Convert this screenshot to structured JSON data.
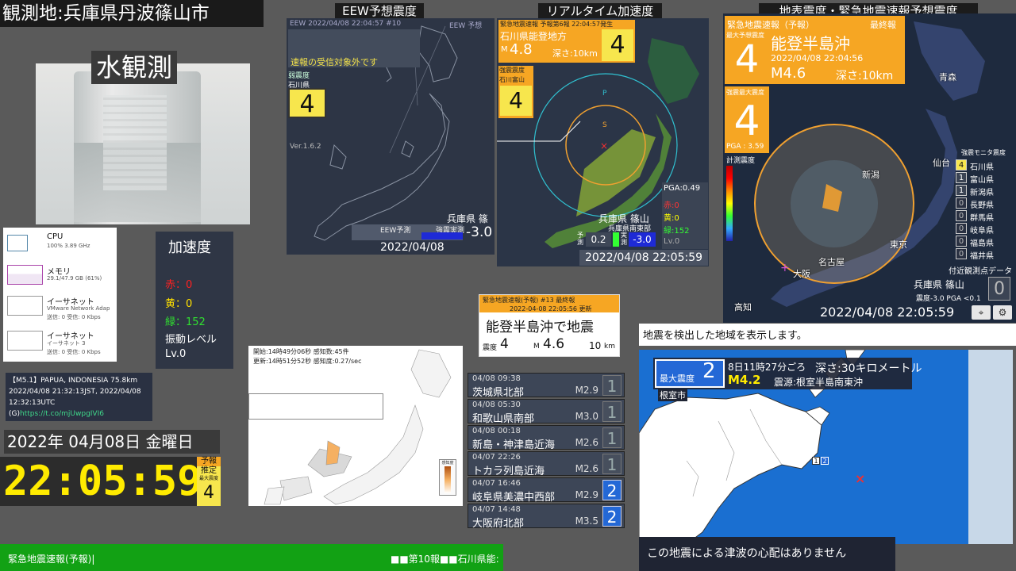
{
  "header": {
    "location_title": "観測地:兵庫県丹波篠山市",
    "water_label": "水観測"
  },
  "eew_forecast_panel": {
    "title": "EEW予想震度",
    "meta_top": "EEW  2022/04/08 22:04:57  #10",
    "meta_right": "EEW 予想",
    "notice": "速報の受信対象外です",
    "weak_label": "弱震度",
    "pref": "石川県",
    "intensity": "4",
    "version": "Ver.1.6.2",
    "station": "兵庫県 篠山",
    "eew_label": "EEW予測",
    "seismic_label": "強震実測",
    "value": "-3.0",
    "timestamp": "2022/04/08  22:05:58"
  },
  "realtime_panel": {
    "title": "リアルタイム加速度",
    "alert_head": "緊急地震速報 予報第6報 22:04:57発生",
    "region": "石川県能登地方",
    "magnitude_prefix": "M",
    "magnitude": "4.8",
    "depth": "深さ:10km",
    "intensity": "4",
    "weak_label": "強震震度",
    "weak_pref": "石川富山",
    "weak_intensity": "4",
    "station": "兵庫県 篠山",
    "pga": "PGA:0.49",
    "red": "赤:0",
    "yellow": "黄:0",
    "green": "緑:152",
    "level": "Lv.0",
    "bottom_station": "兵庫県南東部",
    "left_val": "0.2",
    "right_val": "-3.0",
    "pred_label": "予測",
    "meas_label": "実測",
    "timestamp": "2022/04/08  22:05:59"
  },
  "surface_panel": {
    "title": "地表震度・緊急地震速報予想震度",
    "alert_type": "緊急地震速報（予報）",
    "final": "最終報",
    "max_forecast_label": "最大予想震度",
    "forecast_intensity": "4",
    "epicenter": "能登半島沖",
    "datetime": "2022/04/08  22:04:56",
    "magnitude": "M4.6",
    "depth": "深さ:10km",
    "max_measured_label": "強震最大震度",
    "measured_intensity": "4",
    "pga": "PGA : 3.59",
    "scale_label": "計測震度",
    "monitor_title": "強震モニタ震度",
    "monitor": [
      {
        "v": "4",
        "n": "石川県"
      },
      {
        "v": "1",
        "n": "富山県"
      },
      {
        "v": "1",
        "n": "新潟県"
      },
      {
        "v": "0",
        "n": "長野県"
      },
      {
        "v": "0",
        "n": "群馬県"
      },
      {
        "v": "0",
        "n": "岐阜県"
      },
      {
        "v": "0",
        "n": "福島県"
      },
      {
        "v": "0",
        "n": "福井県"
      }
    ],
    "nearby_label": "付近観測点データ",
    "station": "兵庫県 篠山",
    "station_val": "0",
    "station_detail": "震度-3.0  PGA  <0.1",
    "timestamp": "2022/04/08  22:05:59",
    "city_labels": [
      "青森",
      "仙台",
      "新潟",
      "名古屋",
      "東京",
      "大阪",
      "高知"
    ]
  },
  "sysmon": {
    "cpu_label": "CPU",
    "cpu_detail": "100%  3.89 GHz",
    "mem_label": "メモリ",
    "mem_detail": "29.1/47.9 GB (61%)",
    "eth1_label": "イーサネット",
    "eth1_detail": "VMware Network Adap",
    "eth1_speed": "送信: 0  受信: 0 Kbps",
    "eth2_label": "イーサネット",
    "eth2_detail": "イーサネット 3",
    "eth2_speed": "送信: 0  受信: 0 Kbps"
  },
  "accel": {
    "title": "加速度",
    "red": "赤：0",
    "yellow": "黄：0",
    "green": "緑：152",
    "level_label": "振動レベル",
    "level": "Lv.0"
  },
  "worldquake": {
    "line1": "【M5.1】PAPUA, INDONESIA 75.8km",
    "line2": "2022/04/08 21:32:13JST, 2022/04/08",
    "line3": "12:32:13UTC",
    "line4_prefix": "(G)",
    "line4_link": "https://t.co/mjUwpgIVI6"
  },
  "clock": {
    "date": "2022年 04月08日 金曜日",
    "time": "22:05:59",
    "badge_yoho": "予報",
    "badge_suitei": "推定",
    "badge_max": "最大震度",
    "badge_val": "4"
  },
  "ticker": {
    "left": "緊急地震速報(予報)|",
    "right": "■■第10報■■石川県能:"
  },
  "sensing_map": {
    "line1": "開始:14時49分06秒  感知数:45件",
    "line2": "更新:14時51分52秒  感知度:0.27/sec",
    "legend_title": "感知度"
  },
  "eew_summary": {
    "head": "緊急地震速報(予報) #13 最終報",
    "datetime": "2022-04-08 22:05:56 更新",
    "title": "能登半島沖で地震",
    "intensity_label": "震度",
    "intensity": "4",
    "magnitude_prefix": "M",
    "magnitude": "4.6",
    "depth": "10",
    "depth_unit": "km"
  },
  "quake_list": [
    {
      "date": "04/08  09:38",
      "region": "茨城県北部",
      "mag": "M2.9",
      "int": "1"
    },
    {
      "date": "04/08  05:30",
      "region": "和歌山県南部",
      "mag": "M3.0",
      "int": "1"
    },
    {
      "date": "04/08  00:18",
      "region": "新島・神津島近海",
      "mag": "M2.6",
      "int": "1"
    },
    {
      "date": "04/07  22:26",
      "region": "トカラ列島近海",
      "mag": "M2.6",
      "int": "1"
    },
    {
      "date": "04/07  16:46",
      "region": "岐阜県美濃中西部",
      "mag": "M2.9",
      "int": "2"
    },
    {
      "date": "04/07  14:48",
      "region": "大阪府北部",
      "mag": "M3.5",
      "int": "2"
    }
  ],
  "region_map": {
    "banner": "地震を検出した地域を表示します。",
    "max_label": "最大震度",
    "max_val": "2",
    "when": "8日11時27分ごろ",
    "depth": "深さ:30キロメートル",
    "magnitude": "M4.2",
    "source": "震源:根室半島南東沖",
    "nemuro": "根室市",
    "tsunami": "この地震による津波の心配はありません"
  },
  "colors": {
    "eew_orange": "#f6a623",
    "eew_yellow": "#f7e64d",
    "ticker_green": "#12a114",
    "clock_yellow": "#ffeb00",
    "sea_blue": "#1a6fd1"
  }
}
